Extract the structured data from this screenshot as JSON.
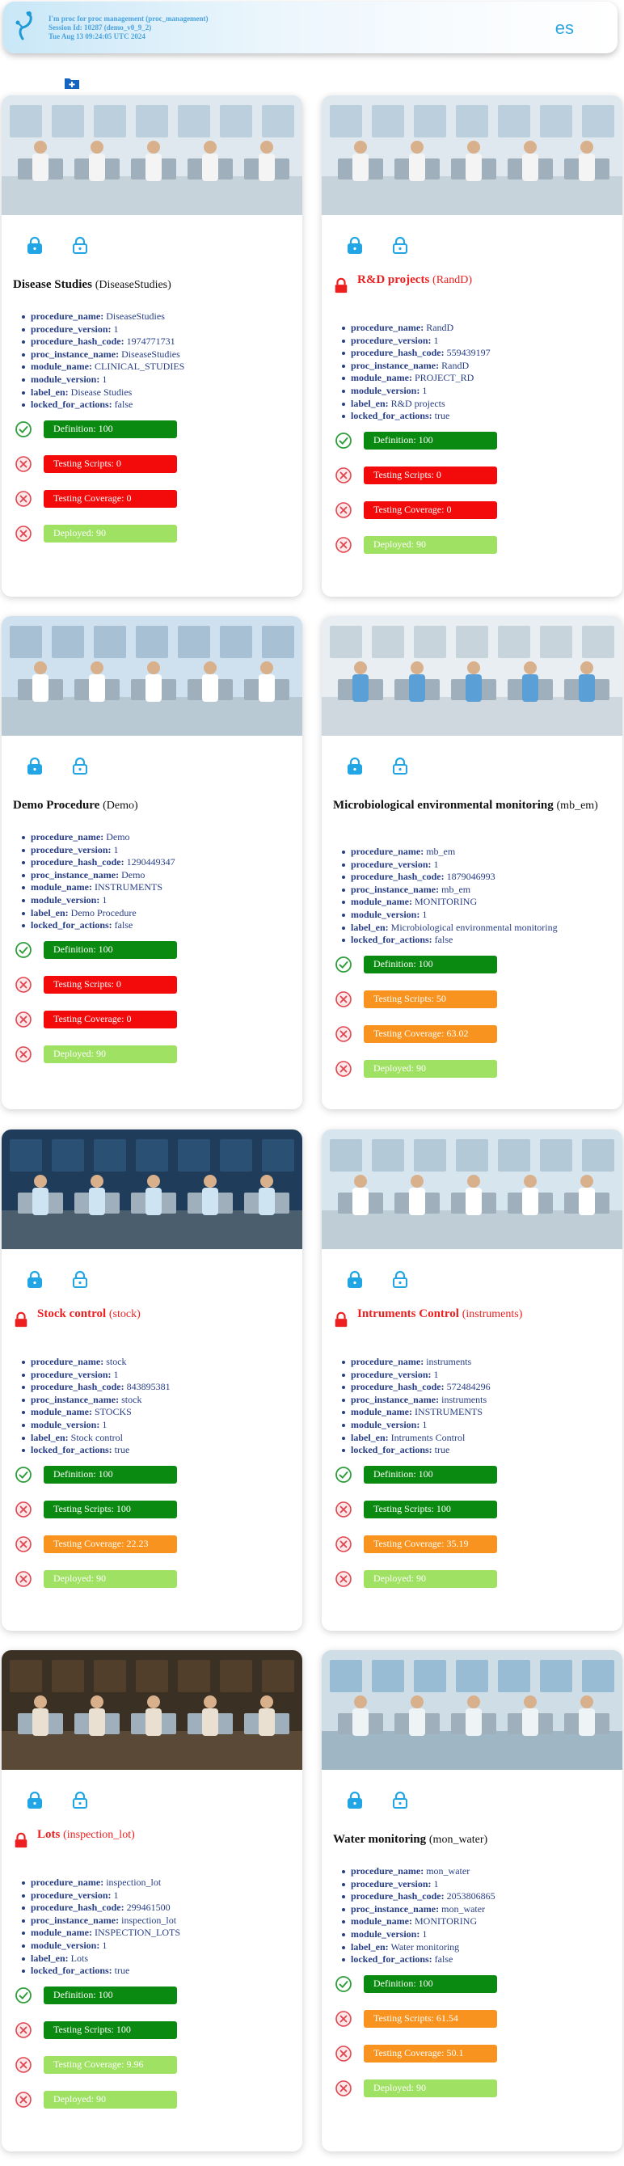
{
  "header": {
    "session_line1": "I'm proc for proc management (proc_management)",
    "session_line2": "Session Id: 10287 (demo_v0_9_2)",
    "session_line3": "Tue Aug 13 09:24:05 UTC 2024",
    "language": "es"
  },
  "colors": {
    "green": "#0a8a10",
    "red": "#f30a0a",
    "orange": "#f7931e",
    "lightgreen": "#9fe163",
    "title_locked": "#ee1f1f"
  },
  "metric_labels": {
    "definition": "Definition:",
    "testing_scripts": "Testing Scripts:",
    "testing_coverage": "Testing Coverage:",
    "deployed": "Deployed:"
  },
  "procedures": [
    {
      "name": "Disease Studies",
      "code": "(DiseaseStudies)",
      "locked": false,
      "props": [
        {
          "k": "procedure_name:",
          "v": "DiseaseStudies"
        },
        {
          "k": "procedure_version:",
          "v": "1"
        },
        {
          "k": "procedure_hash_code:",
          "v": "1974771731"
        },
        {
          "k": "proc_instance_name:",
          "v": "DiseaseStudies"
        },
        {
          "k": "module_name:",
          "v": "CLINICAL_STUDIES"
        },
        {
          "k": "module_version:",
          "v": "1"
        },
        {
          "k": "label_en:",
          "v": "Disease Studies"
        },
        {
          "k": "locked_for_actions:",
          "v": "false"
        }
      ],
      "metrics": [
        {
          "label": "Definition:",
          "value": "100",
          "status": "ok",
          "color": "green"
        },
        {
          "label": "Testing Scripts:",
          "value": "0",
          "status": "fail",
          "color": "red"
        },
        {
          "label": "Testing Coverage:",
          "value": "0",
          "status": "fail",
          "color": "red"
        },
        {
          "label": "Deployed:",
          "value": "90",
          "status": "fail",
          "color": "lightgreen"
        }
      ]
    },
    {
      "name": "R&D projects",
      "code": "(RandD)",
      "locked": true,
      "props": [
        {
          "k": "procedure_name:",
          "v": "RandD"
        },
        {
          "k": "procedure_version:",
          "v": "1"
        },
        {
          "k": "procedure_hash_code:",
          "v": "559439197"
        },
        {
          "k": "proc_instance_name:",
          "v": "RandD"
        },
        {
          "k": "module_name:",
          "v": "PROJECT_RD"
        },
        {
          "k": "module_version:",
          "v": "1"
        },
        {
          "k": "label_en:",
          "v": "R&D projects"
        },
        {
          "k": "locked_for_actions:",
          "v": "true"
        }
      ],
      "metrics": [
        {
          "label": "Definition:",
          "value": "100",
          "status": "ok",
          "color": "green"
        },
        {
          "label": "Testing Scripts:",
          "value": "0",
          "status": "fail",
          "color": "red"
        },
        {
          "label": "Testing Coverage:",
          "value": "0",
          "status": "fail",
          "color": "red"
        },
        {
          "label": "Deployed:",
          "value": "90",
          "status": "fail",
          "color": "lightgreen"
        }
      ]
    },
    {
      "name": "Demo Procedure",
      "code": "(Demo)",
      "locked": false,
      "props": [
        {
          "k": "procedure_name:",
          "v": "Demo"
        },
        {
          "k": "procedure_version:",
          "v": "1"
        },
        {
          "k": "procedure_hash_code:",
          "v": "1290449347"
        },
        {
          "k": "proc_instance_name:",
          "v": "Demo"
        },
        {
          "k": "module_name:",
          "v": "INSTRUMENTS"
        },
        {
          "k": "module_version:",
          "v": "1"
        },
        {
          "k": "label_en:",
          "v": "Demo Procedure"
        },
        {
          "k": "locked_for_actions:",
          "v": "false"
        }
      ],
      "metrics": [
        {
          "label": "Definition:",
          "value": "100",
          "status": "ok",
          "color": "green"
        },
        {
          "label": "Testing Scripts:",
          "value": "0",
          "status": "fail",
          "color": "red"
        },
        {
          "label": "Testing Coverage:",
          "value": "0",
          "status": "fail",
          "color": "red"
        },
        {
          "label": "Deployed:",
          "value": "90",
          "status": "fail",
          "color": "lightgreen"
        }
      ]
    },
    {
      "name": "Microbiological environmental monitoring",
      "code": "(mb_em)",
      "locked": false,
      "props": [
        {
          "k": "procedure_name:",
          "v": "mb_em"
        },
        {
          "k": "procedure_version:",
          "v": "1"
        },
        {
          "k": "procedure_hash_code:",
          "v": "1879046993"
        },
        {
          "k": "proc_instance_name:",
          "v": "mb_em"
        },
        {
          "k": "module_name:",
          "v": "MONITORING"
        },
        {
          "k": "module_version:",
          "v": "1"
        },
        {
          "k": "label_en:",
          "v": "Microbiological environmental monitoring"
        },
        {
          "k": "locked_for_actions:",
          "v": "false"
        }
      ],
      "metrics": [
        {
          "label": "Definition:",
          "value": "100",
          "status": "ok",
          "color": "green"
        },
        {
          "label": "Testing Scripts:",
          "value": "50",
          "status": "fail",
          "color": "orange"
        },
        {
          "label": "Testing Coverage:",
          "value": "63.02",
          "status": "fail",
          "color": "orange"
        },
        {
          "label": "Deployed:",
          "value": "90",
          "status": "fail",
          "color": "lightgreen"
        }
      ]
    },
    {
      "name": "Stock control",
      "code": "(stock)",
      "locked": true,
      "props": [
        {
          "k": "procedure_name:",
          "v": "stock"
        },
        {
          "k": "procedure_version:",
          "v": "1"
        },
        {
          "k": "procedure_hash_code:",
          "v": "843895381"
        },
        {
          "k": "proc_instance_name:",
          "v": "stock"
        },
        {
          "k": "module_name:",
          "v": "STOCKS"
        },
        {
          "k": "module_version:",
          "v": "1"
        },
        {
          "k": "label_en:",
          "v": "Stock control"
        },
        {
          "k": "locked_for_actions:",
          "v": "true"
        }
      ],
      "metrics": [
        {
          "label": "Definition:",
          "value": "100",
          "status": "ok",
          "color": "green"
        },
        {
          "label": "Testing Scripts:",
          "value": "100",
          "status": "fail",
          "color": "green"
        },
        {
          "label": "Testing Coverage:",
          "value": "22.23",
          "status": "fail",
          "color": "orange"
        },
        {
          "label": "Deployed:",
          "value": "90",
          "status": "fail",
          "color": "lightgreen"
        }
      ]
    },
    {
      "name": "Intruments Control",
      "code": "(instruments)",
      "locked": true,
      "props": [
        {
          "k": "procedure_name:",
          "v": "instruments"
        },
        {
          "k": "procedure_version:",
          "v": "1"
        },
        {
          "k": "procedure_hash_code:",
          "v": "572484296"
        },
        {
          "k": "proc_instance_name:",
          "v": "instruments"
        },
        {
          "k": "module_name:",
          "v": "INSTRUMENTS"
        },
        {
          "k": "module_version:",
          "v": "1"
        },
        {
          "k": "label_en:",
          "v": "Intruments Control"
        },
        {
          "k": "locked_for_actions:",
          "v": "true"
        }
      ],
      "metrics": [
        {
          "label": "Definition:",
          "value": "100",
          "status": "ok",
          "color": "green"
        },
        {
          "label": "Testing Scripts:",
          "value": "100",
          "status": "fail",
          "color": "green"
        },
        {
          "label": "Testing Coverage:",
          "value": "35.19",
          "status": "fail",
          "color": "orange"
        },
        {
          "label": "Deployed:",
          "value": "90",
          "status": "fail",
          "color": "lightgreen"
        }
      ]
    },
    {
      "name": "Lots",
      "code": "(inspection_lot)",
      "locked": true,
      "props": [
        {
          "k": "procedure_name:",
          "v": "inspection_lot"
        },
        {
          "k": "procedure_version:",
          "v": "1"
        },
        {
          "k": "procedure_hash_code:",
          "v": "299461500"
        },
        {
          "k": "proc_instance_name:",
          "v": "inspection_lot"
        },
        {
          "k": "module_name:",
          "v": "INSPECTION_LOTS"
        },
        {
          "k": "module_version:",
          "v": "1"
        },
        {
          "k": "label_en:",
          "v": "Lots"
        },
        {
          "k": "locked_for_actions:",
          "v": "true"
        }
      ],
      "metrics": [
        {
          "label": "Definition:",
          "value": "100",
          "status": "ok",
          "color": "green"
        },
        {
          "label": "Testing Scripts:",
          "value": "100",
          "status": "fail",
          "color": "green"
        },
        {
          "label": "Testing Coverage:",
          "value": "9.96",
          "status": "fail",
          "color": "lightgreen"
        },
        {
          "label": "Deployed:",
          "value": "90",
          "status": "fail",
          "color": "lightgreen"
        }
      ]
    },
    {
      "name": "Water monitoring",
      "code": "(mon_water)",
      "locked": false,
      "props": [
        {
          "k": "procedure_name:",
          "v": "mon_water"
        },
        {
          "k": "procedure_version:",
          "v": "1"
        },
        {
          "k": "procedure_hash_code:",
          "v": "2053806865"
        },
        {
          "k": "proc_instance_name:",
          "v": "mon_water"
        },
        {
          "k": "module_name:",
          "v": "MONITORING"
        },
        {
          "k": "module_version:",
          "v": "1"
        },
        {
          "k": "label_en:",
          "v": "Water monitoring"
        },
        {
          "k": "locked_for_actions:",
          "v": "false"
        }
      ],
      "metrics": [
        {
          "label": "Definition:",
          "value": "100",
          "status": "ok",
          "color": "green"
        },
        {
          "label": "Testing Scripts:",
          "value": "61.54",
          "status": "fail",
          "color": "orange"
        },
        {
          "label": "Testing Coverage:",
          "value": "50.1",
          "status": "fail",
          "color": "orange"
        },
        {
          "label": "Deployed:",
          "value": "90",
          "status": "fail",
          "color": "lightgreen"
        }
      ]
    }
  ]
}
